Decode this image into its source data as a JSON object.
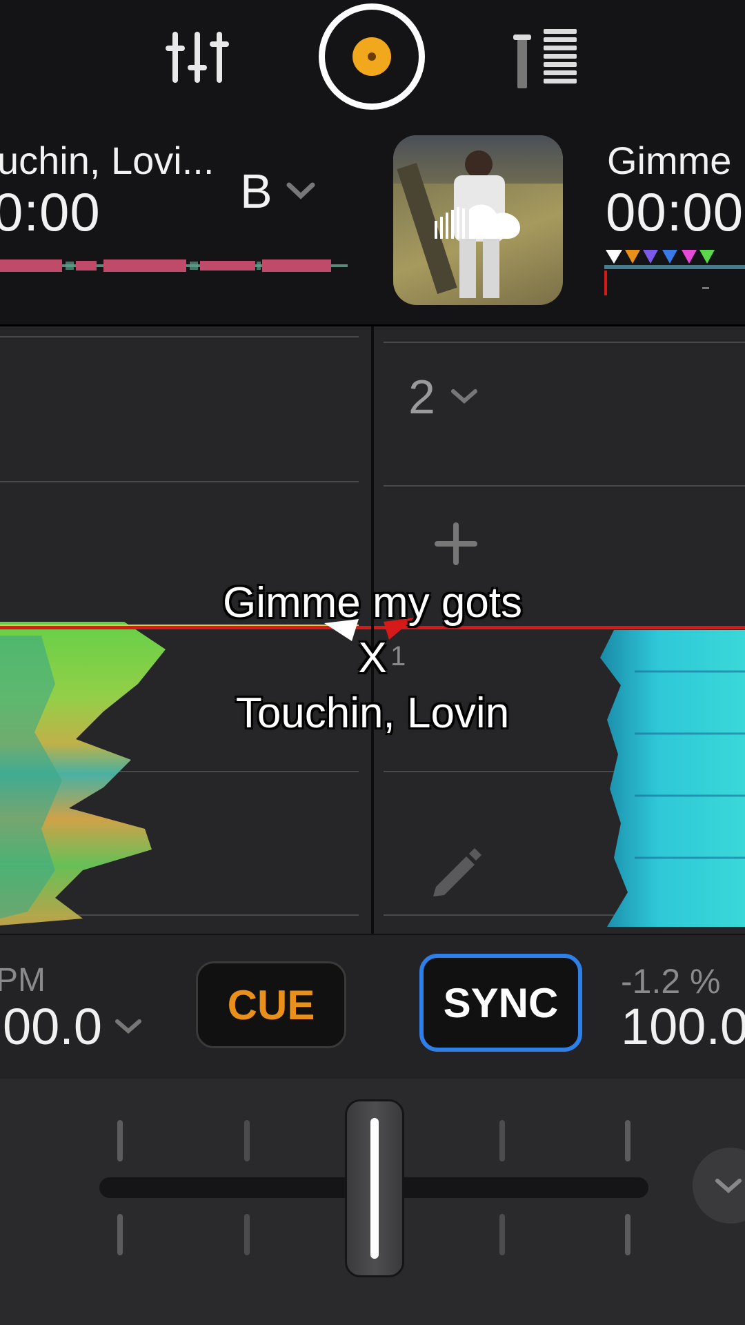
{
  "toolbar": {
    "mixer_icon": "equalizer-sliders-icon",
    "center_icon": "record-disc-icon",
    "right_icon": "level-meter-icon",
    "accent": "#f2a81d"
  },
  "deck_a": {
    "title": "uchin, Lovi...",
    "time": "0:00",
    "deck_letter": "B",
    "bpm_label": "PM",
    "bpm": "00.0",
    "cue_label": "CUE"
  },
  "deck_b": {
    "title": "Gimme",
    "time": "00:00",
    "artwork_icon": "soundcloud-icon",
    "pad_bank": "2",
    "pitch": "-1.2 %",
    "bpm": "100.0",
    "sync_label": "SYNC",
    "cue_number": "1"
  },
  "overlay": {
    "line1": "Gimme my gots",
    "line2": "X",
    "line3": "Touchin, Lovin"
  },
  "colors": {
    "cue": "#e8901a",
    "sync_border": "#2f7fe8",
    "wave_a": "#8bd34a",
    "wave_b": "#2ec8d8",
    "playhead": "#d61a1a"
  }
}
